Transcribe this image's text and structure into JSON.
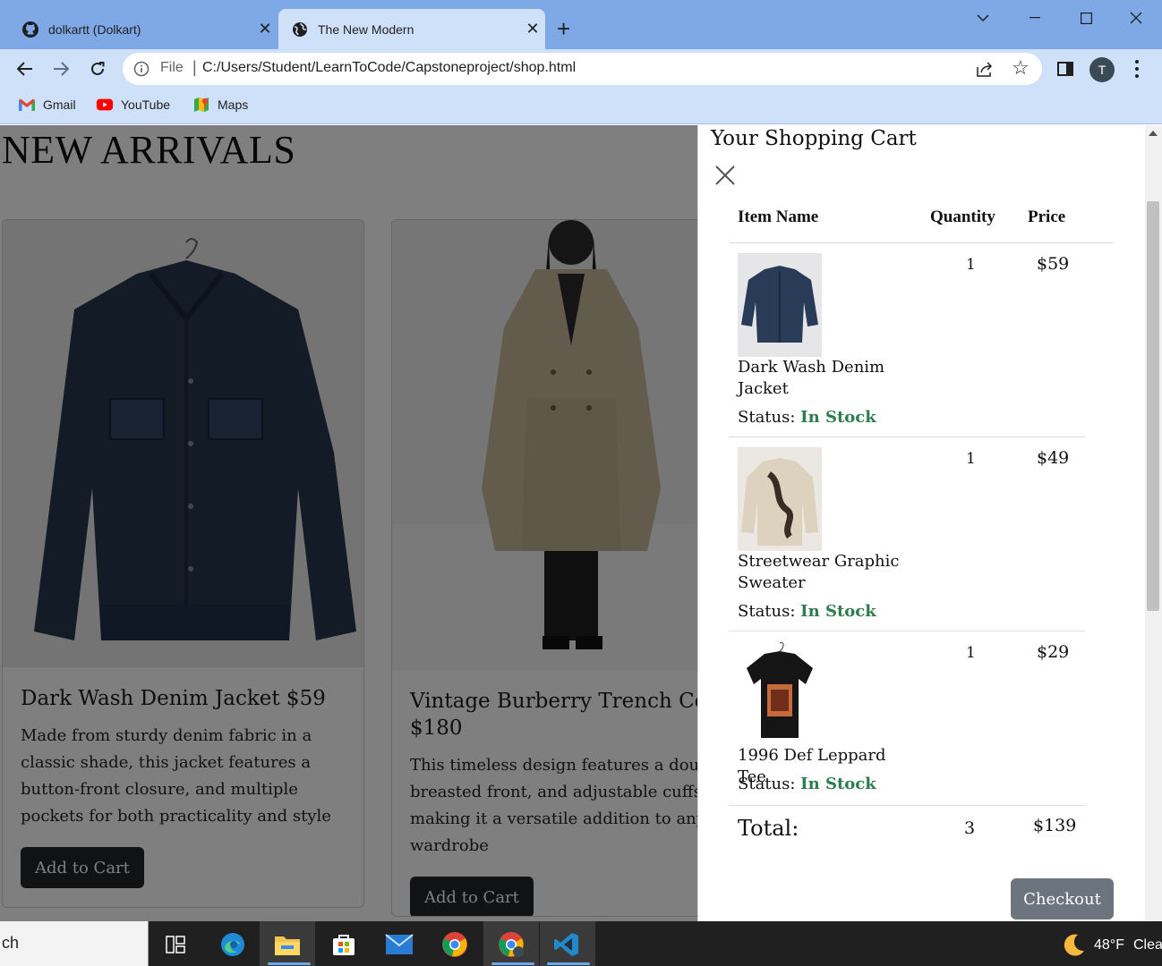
{
  "browser": {
    "tabs": [
      {
        "title": "dolkartt (Dolkart)",
        "icon": "github-icon",
        "active": false
      },
      {
        "title": "The New Modern",
        "icon": "globe-icon",
        "active": true
      }
    ],
    "new_tab": "+",
    "omnibox": {
      "scheme_label": "File",
      "separator": "|",
      "url": "C:/Users/Student/LearnToCode/Capstoneproject/shop.html"
    },
    "profile_initial": "T",
    "bookmarks": [
      {
        "label": "Gmail",
        "icon": "gmail-icon"
      },
      {
        "label": "YouTube",
        "icon": "youtube-icon"
      },
      {
        "label": "Maps",
        "icon": "maps-icon"
      }
    ]
  },
  "page": {
    "title": "NEW ARRIVALS",
    "products": [
      {
        "title": "Dark Wash Denim Jacket $59",
        "description": [
          "Made from sturdy denim fabric in a",
          "classic shade, this jacket features a",
          "button-front closure, and multiple",
          "pockets for both practicality and style"
        ],
        "button": "Add to Cart"
      },
      {
        "title": [
          "Vintage Burberry Trench Coa",
          "$180"
        ],
        "description": [
          "This timeless design features a doubl",
          "breasted front, and adjustable cuffs,",
          "making it a versatile addition to any",
          "wardrobe"
        ],
        "button": "Add to Cart"
      }
    ]
  },
  "cart": {
    "title": "Your Shopping Cart",
    "headers": {
      "name": "Item Name",
      "quantity": "Quantity",
      "price": "Price"
    },
    "status_label": "Status:",
    "items": [
      {
        "name": [
          "Dark Wash Denim",
          "Jacket"
        ],
        "quantity": "1",
        "price": "$59",
        "status": "In Stock"
      },
      {
        "name": [
          "Streetwear Graphic",
          "Sweater"
        ],
        "quantity": "1",
        "price": "$49",
        "status": "In Stock"
      },
      {
        "name": [
          "1996 Def Leppard Tee"
        ],
        "quantity": "1",
        "price": "$29",
        "status": "In Stock"
      }
    ],
    "total": {
      "label": "Total:",
      "quantity": "3",
      "price": "$139"
    },
    "checkout": "Checkout"
  },
  "taskbar": {
    "search_text": "ch",
    "weather": {
      "temp": "48°F",
      "condition": "Clea"
    }
  },
  "colors": {
    "in_stock": "#2e7d4f",
    "tab_bar": "#7fa8e6",
    "toolbar": "#cfe0f9",
    "checkout": "#6c757d",
    "add_to_cart": "#222428"
  }
}
